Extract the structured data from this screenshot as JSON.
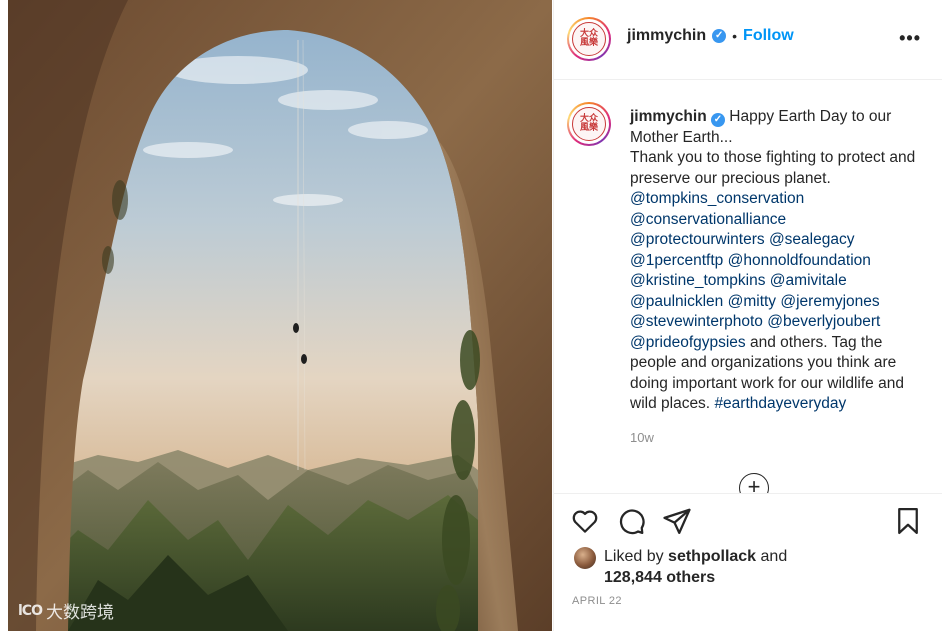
{
  "post": {
    "username": "jimmychin",
    "verified_icon": "verified-badge-icon",
    "follow_label": "Follow",
    "separator": "•",
    "more_label": "•••",
    "avatar_text": "大众 風樂"
  },
  "caption": {
    "username": "jimmychin",
    "intro": "Happy Earth Day to our Mother Earth...",
    "thanks": "Thank you to those fighting to protect and preserve our precious planet.",
    "mentions_line1": [
      "@tompkins_conservation"
    ],
    "mentions_line2": [
      "@conservationalliance"
    ],
    "mentions_line3": [
      "@protectourwinters",
      "@sealegacy"
    ],
    "mentions_line4": [
      "@1percentftp",
      "@honnoldfoundation"
    ],
    "mentions_line5": [
      "@kristine_tompkins",
      "@amivitale"
    ],
    "mentions_line6": [
      "@paulnicklen",
      "@mitty",
      "@jeremyjones"
    ],
    "mentions_line7": [
      "@stevewinterphoto",
      "@beverlyjoubert"
    ],
    "mention_last": "@prideofgypsies",
    "outro": " and others. Tag the people and organizations you think are doing important work for our wildlife and wild places. ",
    "hashtag": "#earthdayeveryday",
    "time_ago": "10w",
    "load_more": "+"
  },
  "actions": {
    "like_icon": "heart-icon",
    "comment_icon": "comment-icon",
    "share_icon": "send-icon",
    "save_icon": "bookmark-icon"
  },
  "likes": {
    "prefix": "Liked by",
    "liker": "sethpollack",
    "conj": "and",
    "count": "128,844 others"
  },
  "date": "APRIL 22",
  "watermark": {
    "logo": "lCO",
    "text": "大数跨境"
  },
  "colors": {
    "link": "#00376b",
    "follow": "#0095f6",
    "muted": "#8e8e8e",
    "verified": "#3897f0"
  }
}
